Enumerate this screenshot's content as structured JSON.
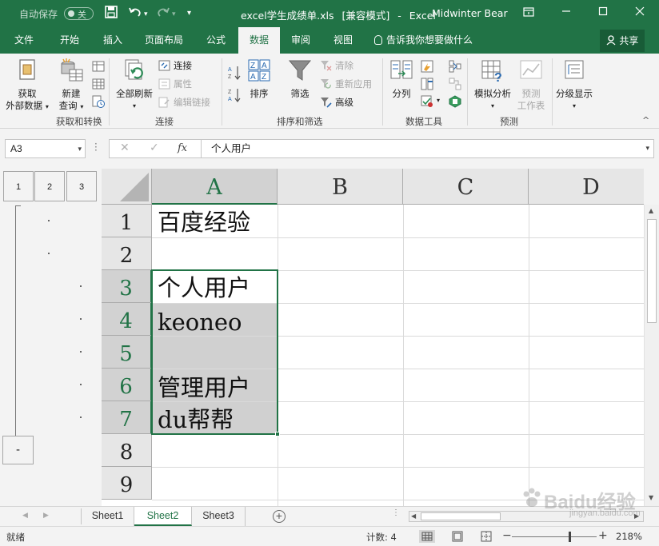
{
  "titlebar": {
    "autosave_label": "自动保存",
    "autosave_state": "关",
    "doc_name": "excel学生成绩单.xls",
    "mode": "[兼容模式]",
    "sep": "-",
    "app": "Excel",
    "user": "Midwinter Bear",
    "icons": [
      "save-icon",
      "undo-icon",
      "redo-icon",
      "customize-icon",
      "ribbon-display-icon",
      "minimize-icon",
      "maximize-icon",
      "close-icon"
    ]
  },
  "tabs": [
    "文件",
    "开始",
    "插入",
    "页面布局",
    "公式",
    "数据",
    "审阅",
    "视图"
  ],
  "active_tab": "数据",
  "tell_me": "告诉我你想要做什么",
  "share": "共享",
  "ribbon": {
    "get_external": [
      "获取",
      "外部数据"
    ],
    "new_query": [
      "新建",
      "查询"
    ],
    "group_get_transform": "获取和转换",
    "refresh_all": "全部刷新",
    "connections": "连接",
    "properties": "属性",
    "edit_links": "编辑链接",
    "group_connections": "连接",
    "sort": "排序",
    "filter": "筛选",
    "clear": "清除",
    "reapply": "重新应用",
    "advanced": "高级",
    "group_sort_filter": "排序和筛选",
    "text_to_columns": "分列",
    "group_data_tools": "数据工具",
    "what_if": "模拟分析",
    "forecast_sheet": [
      "预测",
      "工作表"
    ],
    "group_forecast": "预测",
    "outline": "分级显示"
  },
  "formula_bar": {
    "name_box": "A3",
    "fx": "fx",
    "content": "个人用户"
  },
  "outline_levels": [
    "1",
    "2",
    "3"
  ],
  "outline_collapse": "-",
  "columns": [
    "A",
    "B",
    "C",
    "D"
  ],
  "rows": [
    "1",
    "2",
    "3",
    "4",
    "5",
    "6",
    "7",
    "8",
    "9"
  ],
  "cells": {
    "A1": "百度经验",
    "A2": "",
    "A3": "个人用户",
    "A4": "keoneo",
    "A5": "",
    "A6": "管理用户",
    "A7": "du帮帮"
  },
  "sheets": [
    "Sheet1",
    "Sheet2",
    "Sheet3"
  ],
  "active_sheet": "Sheet2",
  "status": {
    "ready": "就绪",
    "count": "计数: 4",
    "zoom": "218%"
  },
  "watermark": {
    "brand": "Baidu经验",
    "url": "jingyan.baidu.com"
  },
  "colors": {
    "excel_green": "#217346",
    "selection_gray": "#d0d0d0"
  }
}
